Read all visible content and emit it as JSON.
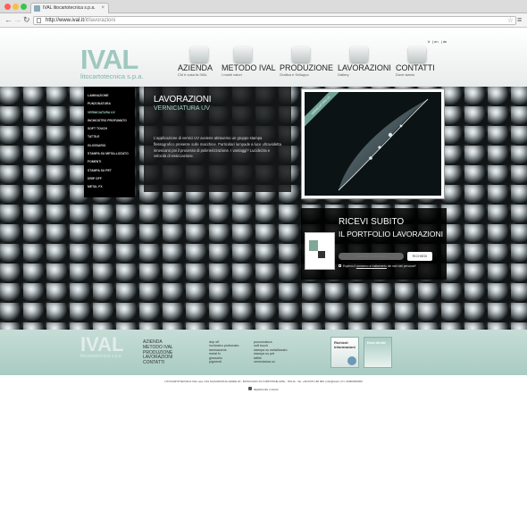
{
  "browser": {
    "tab_title": "IVAL litocartotecnica s.p.a.",
    "url_host": "http://www.ival.it",
    "url_path": "/it/lavorazioni",
    "colors": {
      "red": "#fc605b",
      "yellow": "#fdbc40",
      "green": "#34c84a"
    }
  },
  "header": {
    "langs": [
      "it",
      "en",
      "de"
    ],
    "logo_mark": "IVAL",
    "logo_sub": "litocartotecnica s.p.a.",
    "nav": [
      {
        "label": "AZIENDA",
        "sub": "Chi è cosa fa IVAL"
      },
      {
        "label": "METODO IVAL",
        "sub": "I nostri valori"
      },
      {
        "label": "PRODUZIONE",
        "sub": "Grafica e Sviluppo"
      },
      {
        "label": "LAVORAZIONI",
        "sub": "Gallery"
      },
      {
        "label": "CONTATTI",
        "sub": "Dove siamo"
      }
    ]
  },
  "sidemenu": {
    "items": [
      "LAMINAZIONE",
      "PUNZONATURA",
      "VERNICIATURA UV",
      "INCHIOSTRO PROFUMATO",
      "SOFT TOUCH",
      "TATTILE",
      "GLOSSARIO",
      "STAMPA SU METALLIZZATO",
      "FOMENTI",
      "STAMPA SU PET",
      "DRIP OFF",
      "METAL FX"
    ],
    "active_index": 2
  },
  "content": {
    "title": "LAVORAZIONI",
    "subtitle": "VERNICIATURA UV",
    "body": "L'applicazione di vernici UV avviene attraverso un gruppo stampa flessografico presente sulle macchine. Particolari lampade a luce ultravioletta innescano poi il processo di polimerizzazione. I vantaggi? Lucidezza e velocità di essiccazione."
  },
  "photo": {
    "ribbon": "VERNICIATURA UV"
  },
  "promo": {
    "title": "RICEVI SUBITO",
    "subtitle": "IL PORTFOLIO LAVORAZIONI",
    "email_placeholder": "Inserisci la tua email",
    "button": "RICHIEDI",
    "privacy_prefix": "Esprimo il",
    "privacy_link": "consenso al trattamento",
    "privacy_suffix": "dei miei dati personali*"
  },
  "footer": {
    "logo": "IVAL",
    "logo_sub": "litocartotecnica s.p.a.",
    "col1": [
      "AZIENDA",
      "METODO IVAL",
      "PRODUZIONE",
      "LAVORAZIONI",
      "CONTATTI"
    ],
    "col2": [
      "drip off",
      "inchiostro profumato",
      "laminazione",
      "metal fx",
      "glossario",
      "pigmenti"
    ],
    "col3": [
      "punzonatura",
      "soft touch",
      "stampa su metallizzato",
      "stampa su pet",
      "tattile",
      "verniciatura uv"
    ],
    "box1": "Richiedi informazioni",
    "box2": "fiera diretti",
    "bottom_line": "LITOCARTOTECNICA IVAL spa | VIA SALVADOR ALLENDE 20 - BUSCOLDO DI CURTATONE (MN) - ITALIA - Tel. +39 0376 150 000 | info@ival.it | P.I. 00000000000",
    "credit": "digitalmedia | custom"
  }
}
